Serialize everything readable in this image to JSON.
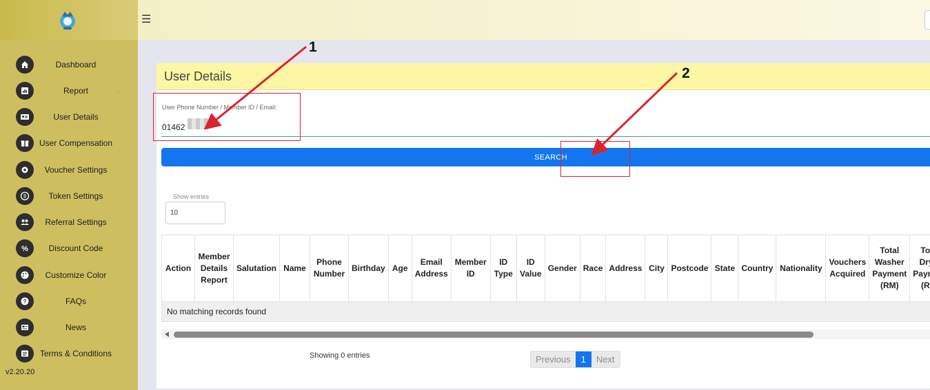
{
  "sidebar": {
    "items": [
      {
        "label": "Dashboard",
        "icon": "home-icon"
      },
      {
        "label": "Report",
        "icon": "report-icon",
        "caret": "›"
      },
      {
        "label": "User Details",
        "icon": "user-card-icon"
      },
      {
        "label": "User Compensation",
        "icon": "gift-icon"
      },
      {
        "label": "Voucher Settings",
        "icon": "gear-icon"
      },
      {
        "label": "Token Settings",
        "icon": "coin-icon"
      },
      {
        "label": "Referral Settings",
        "icon": "users-icon"
      },
      {
        "label": "Discount Code",
        "icon": "percent-icon"
      },
      {
        "label": "Customize Color",
        "icon": "palette-icon"
      },
      {
        "label": "FAQs",
        "icon": "question-icon"
      },
      {
        "label": "News",
        "icon": "newspaper-icon"
      },
      {
        "label": "Terms & Conditions",
        "icon": "document-icon"
      }
    ],
    "version": "v2.20.20"
  },
  "topbar": {
    "menu_glyph": "☰"
  },
  "card": {
    "title": "User Details",
    "search_label": "User Phone Number / Member ID / Email:",
    "search_value": "01462",
    "search_button": "SEARCH",
    "entries_label": "Show entries",
    "entries_value": "10"
  },
  "table": {
    "columns": [
      "Action",
      "Member Details Report",
      "Salutation",
      "Name",
      "Phone Number",
      "Birthday",
      "Age",
      "Email Address",
      "Member ID",
      "ID Type",
      "ID Value",
      "Gender",
      "Race",
      "Address",
      "City",
      "Postcode",
      "State",
      "Country",
      "Nationality",
      "Vouchers Acquired",
      "Total Washer Payment (RM)",
      "Total Dryer Payment (RM)"
    ],
    "empty_message": "No matching records found"
  },
  "footer": {
    "showing": "Showing 0 entries",
    "prev": "Previous",
    "page": "1",
    "next": "Next"
  },
  "annotations": {
    "label_1": "1",
    "label_2": "2",
    "color": "#d8242e"
  },
  "colors": {
    "sidebar": "#cdbf60",
    "header": "#fdf6a4",
    "primary": "#1376f0"
  }
}
